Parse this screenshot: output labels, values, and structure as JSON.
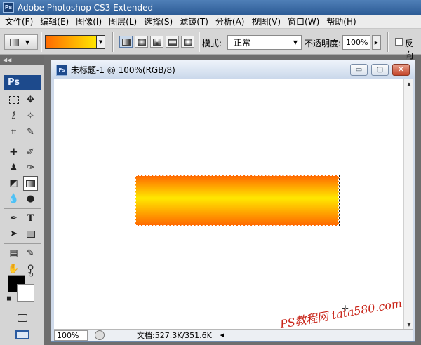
{
  "app": {
    "title": "Adobe Photoshop CS3 Extended",
    "logo_text": "Ps"
  },
  "menu": [
    "文件(F)",
    "编辑(E)",
    "图像(I)",
    "图层(L)",
    "选择(S)",
    "滤镜(T)",
    "分析(A)",
    "视图(V)",
    "窗口(W)",
    "帮助(H)"
  ],
  "options": {
    "gradient_colors": [
      "#ff6a00",
      "#ffe600"
    ],
    "mode_label": "模式:",
    "mode_value": "正常",
    "opacity_label": "不透明度:",
    "opacity_value": "100%",
    "reverse_label": "反向",
    "reverse_checked": false
  },
  "toolbox": {
    "logo_text": "Ps",
    "foreground_color": "#000000",
    "background_color": "#ffffff"
  },
  "document": {
    "title": "未标题-1 @ 100%(RGB/8)",
    "zoom": "100%",
    "doc_info": "文档:527.3K/351.6K",
    "gradient_colors": [
      "#ff6a00",
      "#ffe800",
      "#ff6a00"
    ],
    "watermark": "PS教程网 tata580.com"
  }
}
